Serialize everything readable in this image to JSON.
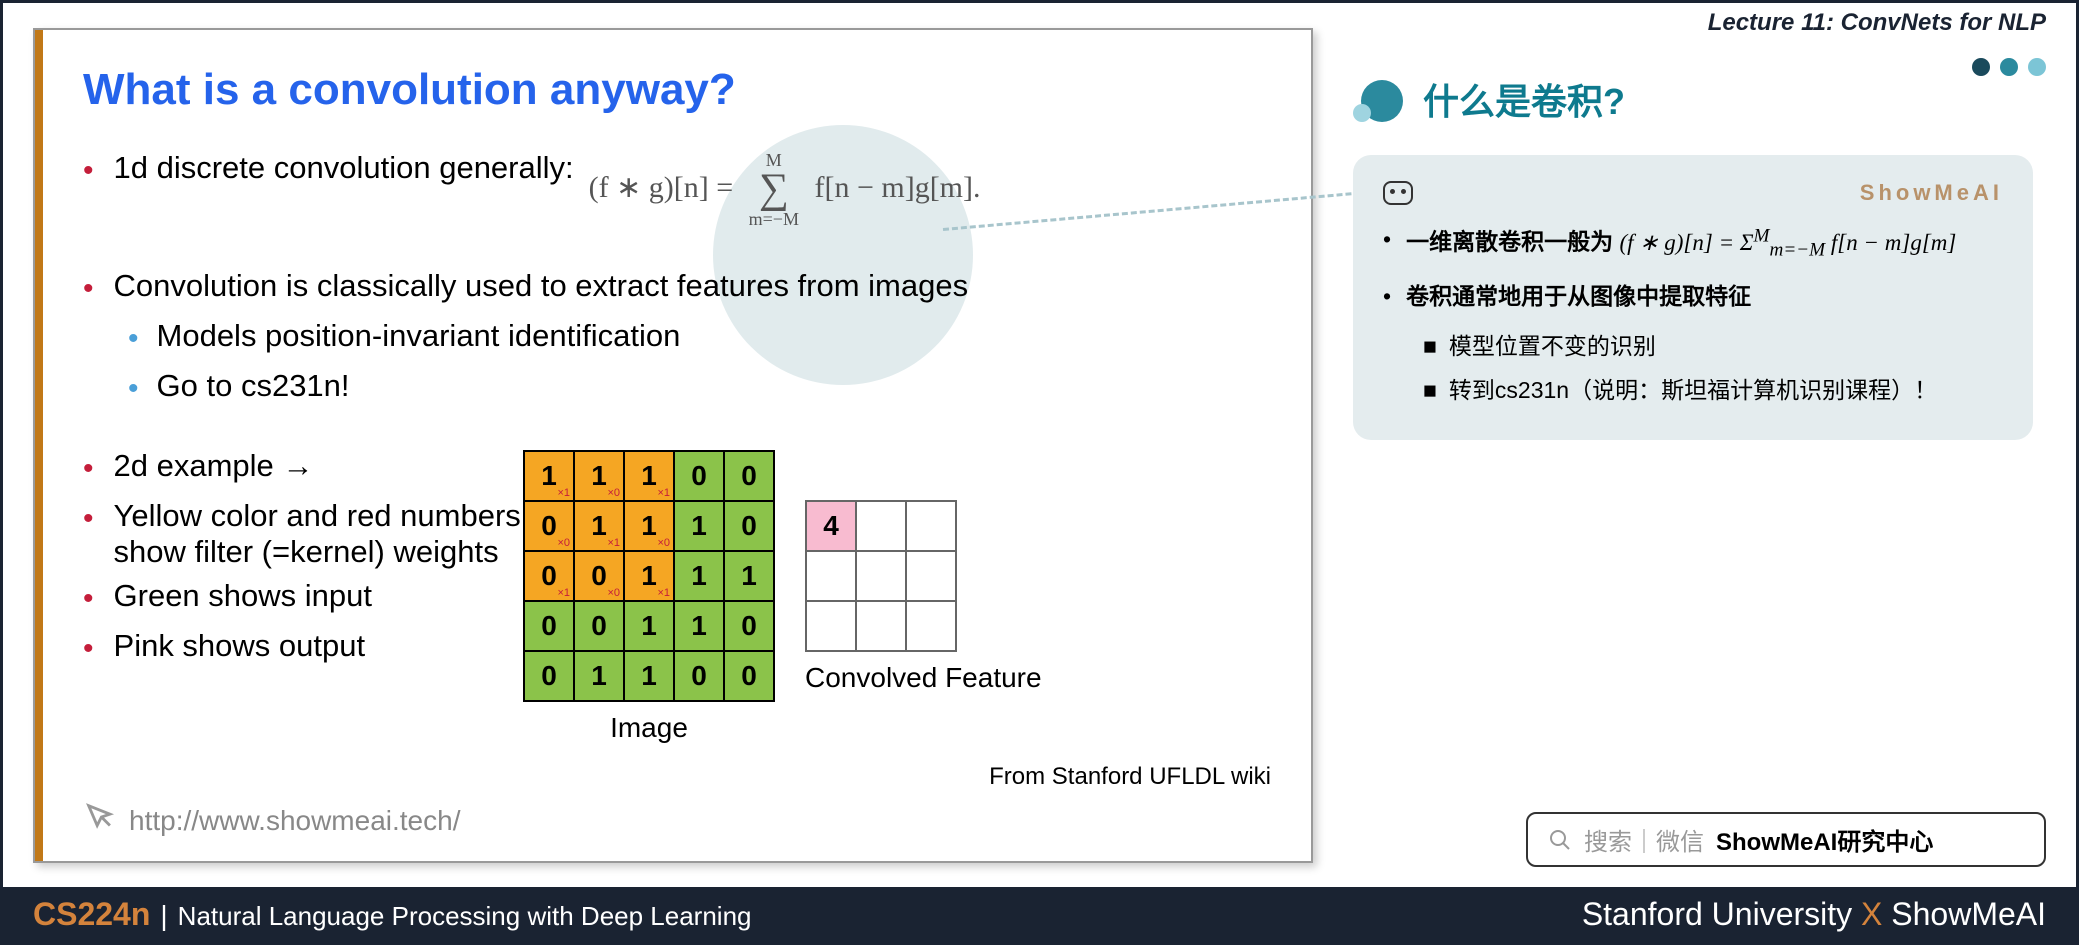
{
  "header": {
    "lecture_title": "Lecture 11: ConvNets for NLP"
  },
  "slide": {
    "title": "What is a convolution anyway?",
    "b1": "1d discrete convolution generally:",
    "formula": {
      "lhs": "(f ∗ g)[n] =",
      "top": "M",
      "bot": "m=−M",
      "rhs": "f[n − m]g[m]."
    },
    "b2": "Convolution is classically used to extract features from images",
    "b2a": "Models position-invariant identification",
    "b2b": "Go to cs231n!",
    "b3": "2d example →",
    "b4": "Yellow color and red numbers show filter (=kernel) weights",
    "b5": "Green shows input",
    "b6": "Pink shows output",
    "image_label": "Image",
    "conv_label": "Convolved Feature",
    "attribution": "From Stanford UFLDL wiki",
    "link": "http://www.showmeai.tech/",
    "grid": {
      "values": [
        [
          "1",
          "1",
          "1",
          "0",
          "0"
        ],
        [
          "0",
          "1",
          "1",
          "1",
          "0"
        ],
        [
          "0",
          "0",
          "1",
          "1",
          "1"
        ],
        [
          "0",
          "0",
          "1",
          "1",
          "0"
        ],
        [
          "0",
          "1",
          "1",
          "0",
          "0"
        ]
      ],
      "kernel_subs": [
        [
          "×1",
          "×0",
          "×1"
        ],
        [
          "×0",
          "×1",
          "×0"
        ],
        [
          "×1",
          "×0",
          "×1"
        ]
      ],
      "output_value": "4"
    }
  },
  "right": {
    "cn_title": "什么是卷积?",
    "brand": "ShowMeAI",
    "cn_b1_prefix": "一维离散卷积一般为",
    "cn_formula": "(f ∗ g)[n] = Σ",
    "cn_formula_sup": "M",
    "cn_formula_sub": "m=−M",
    "cn_formula_rhs": " f[n − m]g[m]",
    "cn_b2": "卷积通常地用于从图像中提取特征",
    "cn_sub1": "模型位置不变的识别",
    "cn_sub2": "转到cs231n（说明：斯坦福计算机识别课程）！"
  },
  "search": {
    "placeholder_left": "搜索｜微信",
    "placeholder_bold": "ShowMeAI研究中心"
  },
  "footer": {
    "course": "CS224n",
    "sep": "|",
    "subtitle": "Natural Language Processing with Deep Learning",
    "right_a": "Stanford University ",
    "right_x": "X",
    "right_b": " ShowMeAI"
  }
}
